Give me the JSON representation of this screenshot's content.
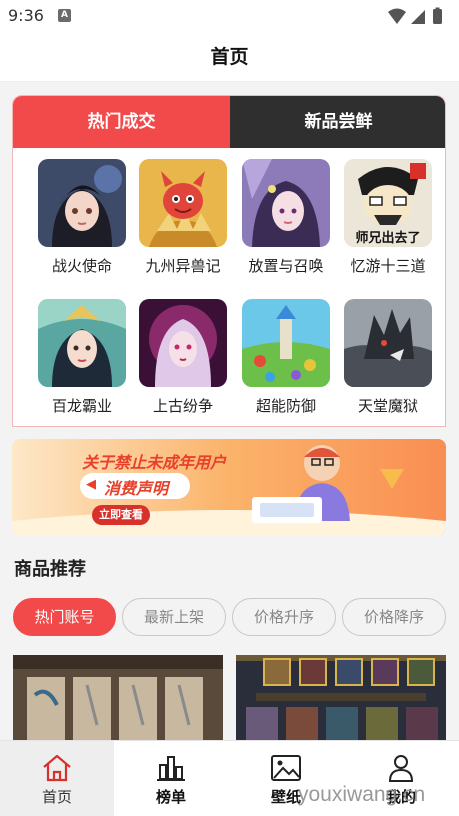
{
  "status_bar": {
    "time": "9:36",
    "notification_badge": "A",
    "icons": [
      "wifi-icon",
      "signal-icon",
      "battery-icon"
    ]
  },
  "header": {
    "title": "首页"
  },
  "tabs": [
    {
      "label": "热门成交",
      "active": true
    },
    {
      "label": "新品尝鲜",
      "active": false
    }
  ],
  "games": [
    {
      "name": "战火使命",
      "icon": "game-warfire-icon"
    },
    {
      "name": "九州异兽记",
      "icon": "game-jiuzhou-icon"
    },
    {
      "name": "放置与召唤",
      "icon": "game-summon-icon"
    },
    {
      "name": "忆游十三道",
      "icon": "game-yiyou-icon",
      "icon_text": "师兄出去了"
    },
    {
      "name": "百龙霸业",
      "icon": "game-bailong-icon"
    },
    {
      "name": "上古纷争",
      "icon": "game-shanggu-icon"
    },
    {
      "name": "超能防御",
      "icon": "game-defense-icon"
    },
    {
      "name": "天堂魔狱",
      "icon": "game-heaven-icon"
    }
  ],
  "banner": {
    "headline": "关于禁止未成年用户",
    "subtitle": "消费声明",
    "button": "立即查看"
  },
  "section": {
    "title": "商品推荐"
  },
  "filters": [
    {
      "label": "热门账号",
      "active": true
    },
    {
      "label": "最新上架",
      "active": false
    },
    {
      "label": "价格升序",
      "active": false
    },
    {
      "label": "价格降序",
      "active": false
    }
  ],
  "products": [
    {
      "image": "product-card-game-screenshot"
    },
    {
      "image": "product-card-hero-screenshot"
    }
  ],
  "bottom_nav": [
    {
      "label": "首页",
      "icon": "home-icon",
      "active": true
    },
    {
      "label": "榜单",
      "icon": "chart-icon",
      "active": false
    },
    {
      "label": "壁纸",
      "icon": "image-icon",
      "active": false
    },
    {
      "label": "我的",
      "icon": "user-icon",
      "active": false
    }
  ],
  "watermark": "youxiwang.cn",
  "colors": {
    "accent": "#f24a4a",
    "dark_tab": "#2f2f2f",
    "page_bg": "#f3f3f3"
  }
}
